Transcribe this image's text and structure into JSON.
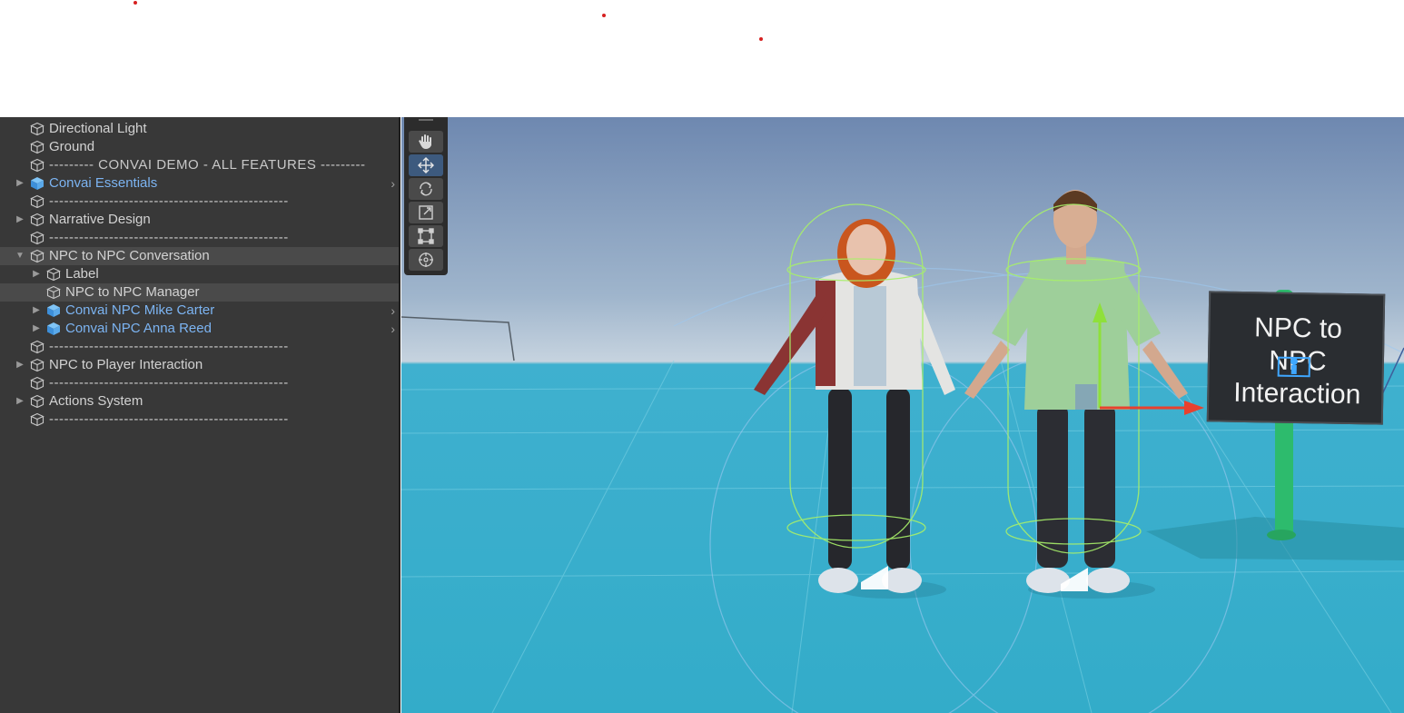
{
  "hierarchy": {
    "items": [
      {
        "label": "Directional Light",
        "depth": 0,
        "expander": "none",
        "prefab": false,
        "separator": false,
        "selected": false,
        "has_chevron": false
      },
      {
        "label": "Ground",
        "depth": 0,
        "expander": "none",
        "prefab": false,
        "separator": false,
        "selected": false,
        "has_chevron": false
      },
      {
        "label": "--------- CONVAI DEMO - ALL FEATURES ---------",
        "depth": 0,
        "expander": "none",
        "prefab": false,
        "separator": true,
        "selected": false,
        "has_chevron": false
      },
      {
        "label": "Convai Essentials",
        "depth": 0,
        "expander": "collapsed",
        "prefab": true,
        "separator": false,
        "selected": false,
        "has_chevron": true
      },
      {
        "label": "------------------------------------------------",
        "depth": 0,
        "expander": "none",
        "prefab": false,
        "separator": true,
        "selected": false,
        "has_chevron": false
      },
      {
        "label": "Narrative Design",
        "depth": 0,
        "expander": "collapsed",
        "prefab": false,
        "separator": false,
        "selected": false,
        "has_chevron": false
      },
      {
        "label": "------------------------------------------------",
        "depth": 0,
        "expander": "none",
        "prefab": false,
        "separator": true,
        "selected": false,
        "has_chevron": false
      },
      {
        "label": "NPC to NPC Conversation",
        "depth": 0,
        "expander": "expanded",
        "prefab": false,
        "separator": false,
        "selected": true,
        "has_chevron": false
      },
      {
        "label": "Label",
        "depth": 1,
        "expander": "collapsed",
        "prefab": false,
        "separator": false,
        "selected": false,
        "has_chevron": false
      },
      {
        "label": "NPC to NPC Manager",
        "depth": 1,
        "expander": "none",
        "prefab": false,
        "separator": false,
        "selected": true,
        "has_chevron": false
      },
      {
        "label": "Convai NPC Mike Carter",
        "depth": 1,
        "expander": "collapsed",
        "prefab": true,
        "separator": false,
        "selected": false,
        "has_chevron": true
      },
      {
        "label": "Convai NPC Anna Reed",
        "depth": 1,
        "expander": "collapsed",
        "prefab": true,
        "separator": false,
        "selected": false,
        "has_chevron": true
      },
      {
        "label": "------------------------------------------------",
        "depth": 0,
        "expander": "none",
        "prefab": false,
        "separator": true,
        "selected": false,
        "has_chevron": false
      },
      {
        "label": "NPC to Player Interaction",
        "depth": 0,
        "expander": "collapsed",
        "prefab": false,
        "separator": false,
        "selected": false,
        "has_chevron": false
      },
      {
        "label": "------------------------------------------------",
        "depth": 0,
        "expander": "none",
        "prefab": false,
        "separator": true,
        "selected": false,
        "has_chevron": false
      },
      {
        "label": "Actions System",
        "depth": 0,
        "expander": "collapsed",
        "prefab": false,
        "separator": false,
        "selected": false,
        "has_chevron": false
      },
      {
        "label": "------------------------------------------------",
        "depth": 0,
        "expander": "none",
        "prefab": false,
        "separator": true,
        "selected": false,
        "has_chevron": false
      }
    ]
  },
  "toolbar": {
    "tools": [
      {
        "name": "hand-tool",
        "icon": "hand-icon",
        "active": false
      },
      {
        "name": "move-tool",
        "icon": "move-arrows-icon",
        "active": true
      },
      {
        "name": "rotate-tool",
        "icon": "rotate-icon",
        "active": false
      },
      {
        "name": "scale-tool",
        "icon": "scale-icon",
        "active": false
      },
      {
        "name": "rect-tool",
        "icon": "rect-transform-icon",
        "active": false
      },
      {
        "name": "transform-tool",
        "icon": "transform-icon",
        "active": false
      }
    ]
  },
  "scene": {
    "sign_text": "NPC to\nNPC\nInteraction",
    "colors": {
      "sky_top": "#6e88b0",
      "ground": "#33acc9",
      "collider": "#9cf05a",
      "gizmo_y": "#8fe03a",
      "gizmo_x": "#e8412e",
      "prefab_text": "#7cb4f2",
      "panel_bg": "#383838"
    }
  }
}
